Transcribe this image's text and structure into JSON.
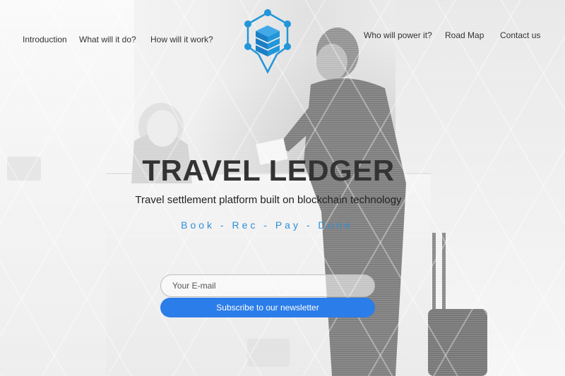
{
  "nav": {
    "left": [
      {
        "label": "Introduction"
      },
      {
        "label": "What will it do?"
      },
      {
        "label": "How will it work?"
      }
    ],
    "right": [
      {
        "label": "Who will power it?"
      },
      {
        "label": "Road Map"
      },
      {
        "label": "Contact us"
      }
    ]
  },
  "hero": {
    "title": "TRAVEL LEDGER",
    "subtitle": "Travel settlement platform built on blockchain technology",
    "tagline": "Book - Rec - Pay - Done"
  },
  "newsletter": {
    "email_placeholder": "Your E-mail",
    "subscribe_label": "Subscribe to our newsletter"
  },
  "colors": {
    "accent": "#2b7de9",
    "logo_blue": "#2196d9",
    "tagline": "#2f8fd6",
    "title": "#333333"
  },
  "icons": {
    "logo": "blockchain-cube-pin-icon"
  }
}
